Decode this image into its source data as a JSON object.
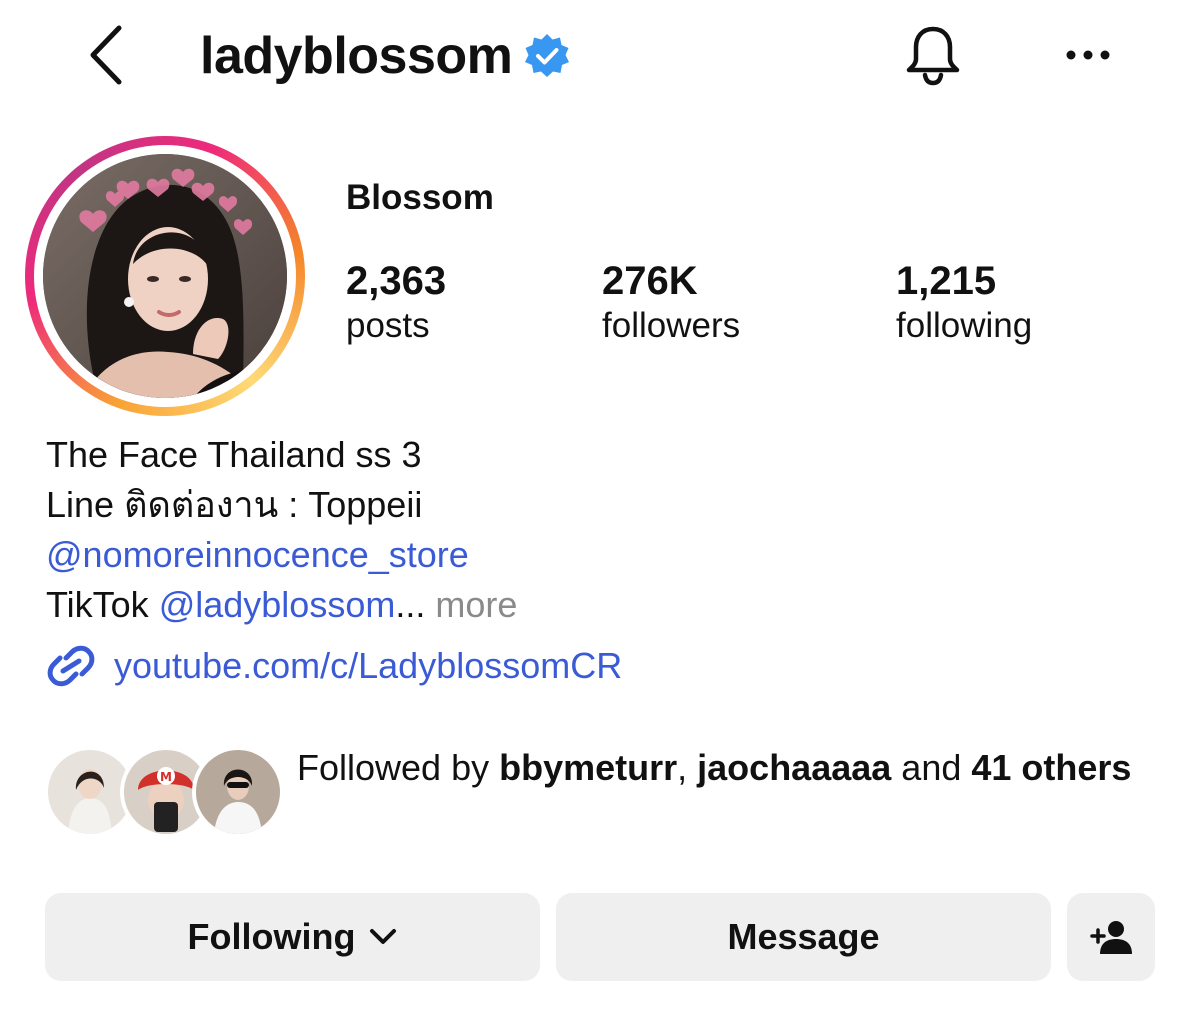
{
  "header": {
    "username": "ladyblossom",
    "verified": true,
    "accent_color": "#3897f0"
  },
  "profile": {
    "display_name": "Blossom",
    "stats": [
      {
        "value": "2,363",
        "label": "posts"
      },
      {
        "value": "276K",
        "label": "followers"
      },
      {
        "value": "1,215",
        "label": "following"
      }
    ]
  },
  "bio": {
    "line1": "The Face Thailand ss 3",
    "line2": "Line ติดต่องาน : Toppeii",
    "store_mention": "@nomoreinnocence_store",
    "tiktok_prefix": "TikTok ",
    "tiktok_mention": "@ladyblossom",
    "ellipsis": "...",
    "more_label": " more",
    "link_color": "#3b5bd6"
  },
  "external_link": {
    "url_text": "youtube.com/c/LadyblossomCR"
  },
  "followed_by": {
    "prefix": "Followed by ",
    "user1": "bbymeturr",
    "separator": ", ",
    "user2": "jaochaaaaa",
    "conjunction": " and ",
    "count_text": "41 others"
  },
  "actions": {
    "following_label": "Following",
    "message_label": "Message",
    "button_bg": "#efefef"
  },
  "icons": {
    "back": "chevron-left-icon",
    "verified": "verified-badge-icon",
    "notifications": "bell-icon",
    "more": "more-horizontal-icon",
    "link": "link-icon",
    "dropdown": "chevron-down-icon",
    "add_person": "add-person-icon"
  }
}
